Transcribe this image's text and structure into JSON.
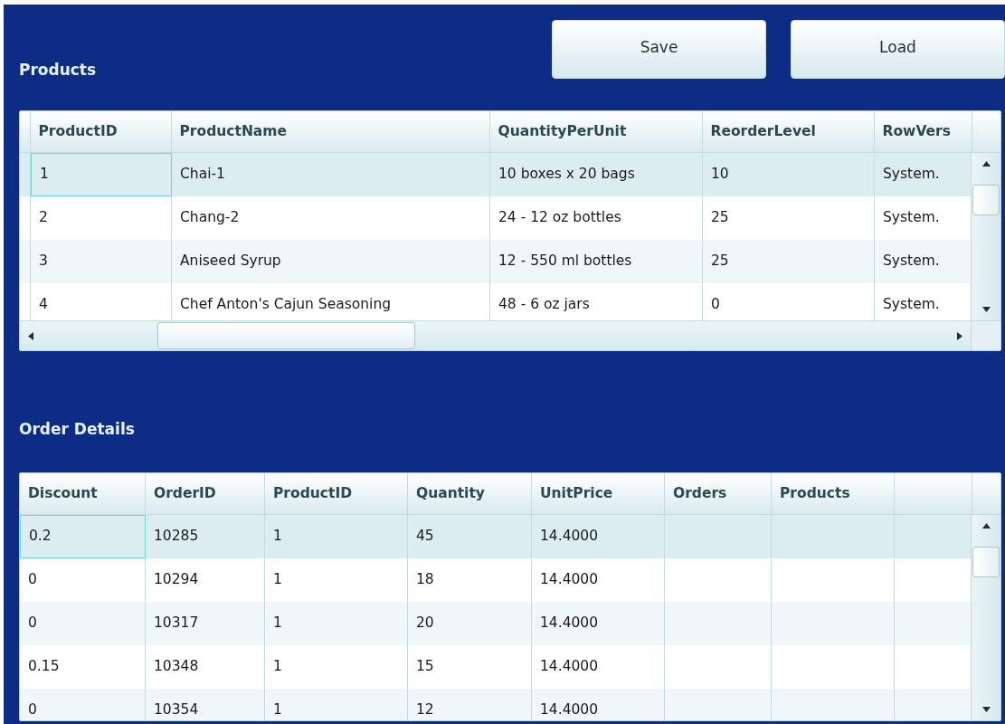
{
  "buttons": [
    {
      "label": "Save"
    },
    {
      "label": "Load"
    }
  ],
  "products": {
    "title": "Products",
    "columns": [
      "ProductID",
      "ProductName",
      "QuantityPerUnit",
      "ReorderLevel",
      "RowVers"
    ],
    "rows": [
      {
        "cells": [
          "1",
          "Chai-1",
          "10 boxes x 20 bags",
          "10",
          "System."
        ],
        "selected": true
      },
      {
        "cells": [
          "2",
          "Chang-2",
          "24 - 12 oz bottles",
          "25",
          "System."
        ],
        "selected": false
      },
      {
        "cells": [
          "3",
          "Aniseed Syrup",
          "12 - 550 ml bottles",
          "25",
          "System."
        ],
        "selected": false
      },
      {
        "cells": [
          "4",
          "Chef Anton's Cajun Seasoning",
          "48 - 6 oz jars",
          "0",
          "System."
        ],
        "selected": false
      }
    ]
  },
  "order_details": {
    "title": "Order Details",
    "columns": [
      "Discount",
      "OrderID",
      "ProductID",
      "Quantity",
      "UnitPrice",
      "Orders",
      "Products"
    ],
    "rows": [
      {
        "cells": [
          "0.2",
          "10285",
          "1",
          "45",
          "14.4000"
        ],
        "selected": true
      },
      {
        "cells": [
          "0",
          "10294",
          "1",
          "18",
          "14.4000"
        ],
        "selected": false
      },
      {
        "cells": [
          "0",
          "10317",
          "1",
          "20",
          "14.4000"
        ],
        "selected": false
      },
      {
        "cells": [
          "0.15",
          "10348",
          "1",
          "15",
          "14.4000"
        ],
        "selected": false
      },
      {
        "cells": [
          "0",
          "10354",
          "1",
          "12",
          "14.4000"
        ],
        "selected": false
      }
    ]
  }
}
